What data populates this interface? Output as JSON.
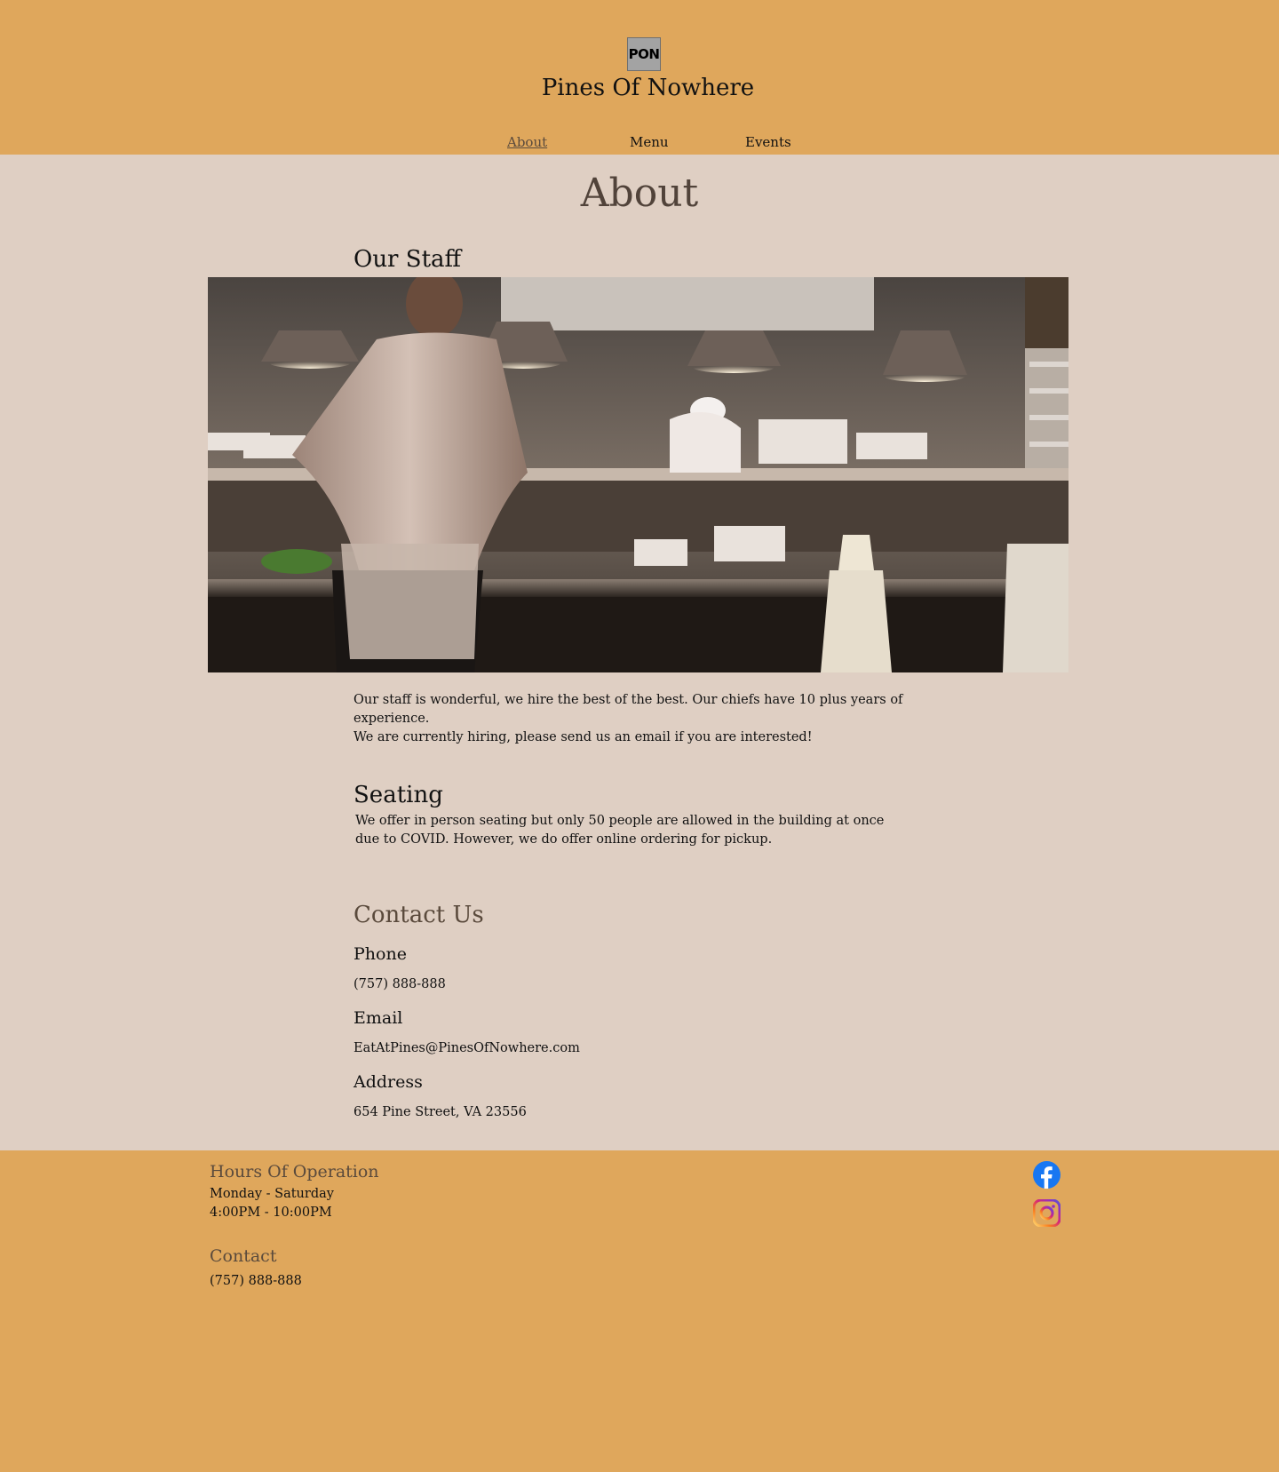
{
  "header": {
    "logo_text": "PON",
    "site_title": "Pines Of Nowhere",
    "nav": [
      {
        "label": "About"
      },
      {
        "label": "Menu"
      },
      {
        "label": "Events"
      }
    ]
  },
  "main": {
    "page_title": "About",
    "staff": {
      "heading": "Our Staff",
      "line1": "Our staff is wonderful, we hire the best of the best. Our chiefs have 10 plus years of experience.",
      "line2": "We are currently hiring, please send us an email if you are interested!"
    },
    "seating": {
      "heading": "Seating",
      "text": "We offer in person seating but only 50 people are allowed in the building at once due to COVID. However, we do offer online ordering for pickup."
    },
    "contact": {
      "heading": "Contact Us",
      "phone_label": "Phone",
      "phone_value": "(757) 888-888",
      "email_label": "Email",
      "email_value": "EatAtPines@PinesOfNowhere.com",
      "address_label": "Address",
      "address_value": "654 Pine Street, VA 23556"
    }
  },
  "footer": {
    "hours_heading": "Hours Of Operation",
    "hours_days": "Monday - Saturday",
    "hours_time": "4:00PM - 10:00PM",
    "contact_heading": "Contact",
    "contact_phone": "(757) 888-888"
  },
  "icons": {
    "facebook": "facebook-icon",
    "instagram": "instagram-icon"
  },
  "colors": {
    "header_bg": "#dfa75c",
    "main_bg": "#dfcfc3",
    "heading_brown": "#5a4a3c",
    "facebook_blue": "#1877f2"
  }
}
